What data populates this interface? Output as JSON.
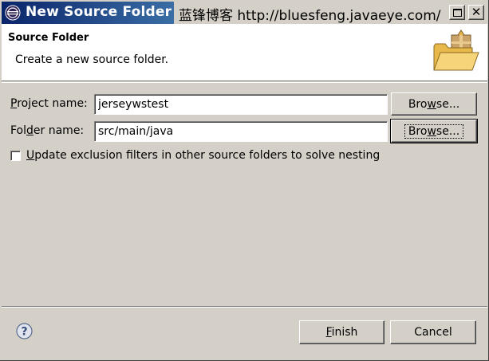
{
  "window": {
    "title": "New Source Folder",
    "watermark": "蓝锋博客  http://bluesfeng.javaeye.com/"
  },
  "banner": {
    "title": "Source Folder",
    "description": "Create a new source folder.",
    "image": "folder-package-icon"
  },
  "form": {
    "project_label_prefix": "P",
    "project_label_rest": "roject name:",
    "project_value": "jerseywstest",
    "project_browse": {
      "pre": "Bro",
      "mn": "w",
      "post": "se..."
    },
    "folder_label_pre": "Fol",
    "folder_label_mn": "d",
    "folder_label_rest": "er name:",
    "folder_value": "src/main/java",
    "folder_browse": {
      "pre": "Bro",
      "mn": "w",
      "post": "se..."
    },
    "checkbox_mn": "U",
    "checkbox_rest": "pdate exclusion filters in other source folders to solve nesting",
    "checkbox_checked": false
  },
  "footer": {
    "help_icon": "help-icon",
    "finish_mn": "F",
    "finish_rest": "inish",
    "cancel_label": "Cancel"
  }
}
